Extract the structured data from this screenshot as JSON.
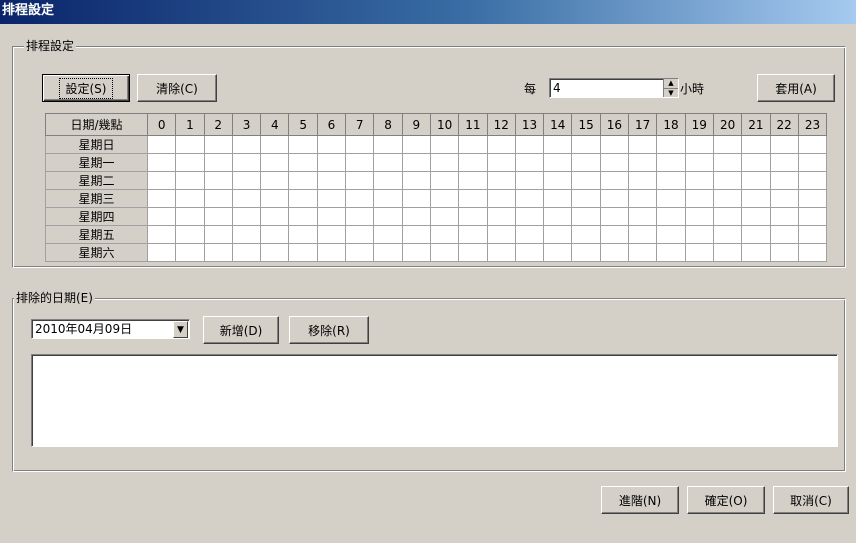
{
  "window": {
    "title": "排程設定"
  },
  "schedule_group": {
    "legend": "排程設定",
    "set_button": "設定(S)",
    "clear_button": "清除(C)",
    "every_label": "每",
    "every_value": "4",
    "hours_label": "小時",
    "apply_button": "套用(A)",
    "table": {
      "corner_header": "日期/幾點",
      "hours": [
        "0",
        "1",
        "2",
        "3",
        "4",
        "5",
        "6",
        "7",
        "8",
        "9",
        "10",
        "11",
        "12",
        "13",
        "14",
        "15",
        "16",
        "17",
        "18",
        "19",
        "20",
        "21",
        "22",
        "23"
      ],
      "days": [
        "星期日",
        "星期一",
        "星期二",
        "星期三",
        "星期四",
        "星期五",
        "星期六"
      ]
    }
  },
  "exclude_group": {
    "legend": "排除的日期(E)",
    "date_value": "2010年04月09日",
    "add_button": "新增(D)",
    "remove_button": "移除(R)"
  },
  "footer": {
    "advanced_button": "進階(N)",
    "ok_button": "確定(O)",
    "cancel_button": "取消(C)"
  }
}
